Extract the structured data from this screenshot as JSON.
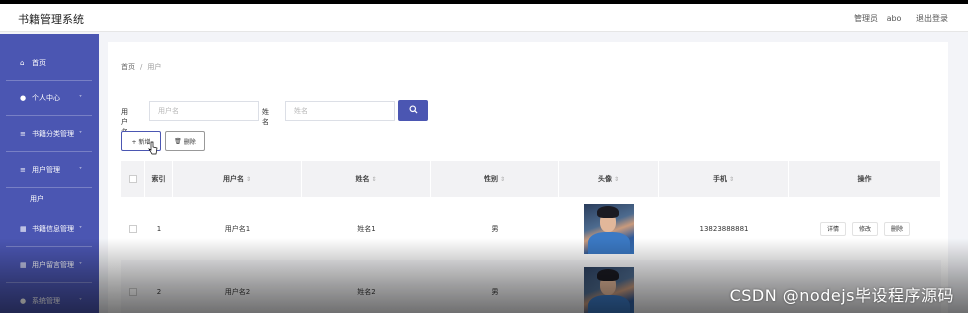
{
  "header": {
    "title": "书籍管理系统",
    "role": "管理员",
    "username": "abo",
    "logout": "退出登录"
  },
  "sidebar": {
    "items": [
      {
        "label": "首页",
        "icon": "home-icon",
        "glyph": "⌂"
      },
      {
        "label": "个人中心",
        "icon": "user-icon",
        "glyph": "●",
        "chev": "˅"
      },
      {
        "label": "书籍分类管理",
        "icon": "list-icon",
        "glyph": "≡",
        "chev": "˅"
      },
      {
        "label": "用户管理",
        "icon": "list-icon",
        "glyph": "≡",
        "chev": "˅"
      },
      {
        "label": "书籍信息管理",
        "icon": "grid-icon",
        "glyph": "▦",
        "chev": "˅"
      },
      {
        "label": "用户留言管理",
        "icon": "grid-icon",
        "glyph": "▦",
        "chev": "˅"
      },
      {
        "label": "系统管理",
        "icon": "user-icon",
        "glyph": "●",
        "chev": "˅"
      }
    ],
    "sub_item": "用户"
  },
  "breadcrumb": {
    "home": "首页",
    "sep": "/",
    "current": "用户"
  },
  "search": {
    "username_label": "用户名",
    "username_placeholder": "用户名",
    "name_label": "姓名",
    "name_placeholder": "姓名",
    "button_icon": "search-icon"
  },
  "actions": {
    "add": "+ 新增",
    "delete": "删除"
  },
  "table": {
    "headers": {
      "index": "索引",
      "username": "用户名",
      "name": "姓名",
      "gender": "性别",
      "avatar": "头像",
      "phone": "手机",
      "ops": "操作"
    },
    "sort_glyph": "⇕",
    "rows": [
      {
        "index": "1",
        "username": "用户名1",
        "name": "姓名1",
        "gender": "男",
        "phone": "13823888881"
      },
      {
        "index": "2",
        "username": "用户名2",
        "name": "姓名2",
        "gender": "男",
        "phone": ""
      }
    ],
    "row_ops": {
      "detail": "详情",
      "edit": "修改",
      "delete": "删除"
    }
  },
  "watermark": "CSDN @nodejs毕设程序源码",
  "colors": {
    "accent": "#4b56b2",
    "header_bg": "#f2f2f4"
  }
}
